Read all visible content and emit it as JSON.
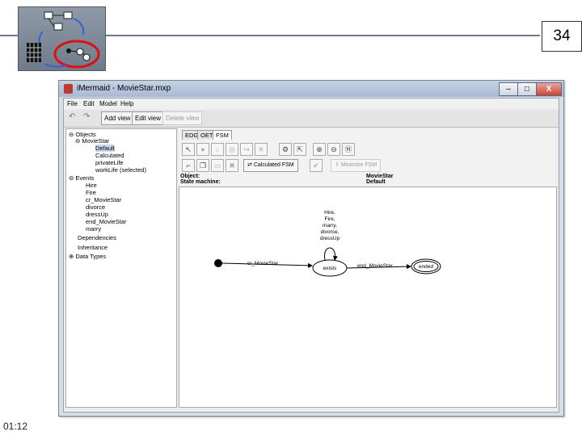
{
  "slide": {
    "page_number": "34",
    "clock": "01:12"
  },
  "window": {
    "title": "iMermaid - MovieStar.mxp",
    "controls": {
      "minimize": "–",
      "maximize": "□",
      "close": "X"
    }
  },
  "menu": [
    "File",
    "Edit",
    "Model",
    "Help"
  ],
  "toolbar": {
    "undo": "↶",
    "redo": "↷",
    "add_view": "Add view",
    "edit_view": "Edit view",
    "delete_view": "Delete view"
  },
  "tree": {
    "items": [
      {
        "label": "Objects",
        "prefix": "⊖ "
      },
      {
        "label": "MovieStar",
        "prefix": "⊖ "
      },
      {
        "label": "Default",
        "prefix": ""
      },
      {
        "label": "Calculated",
        "prefix": ""
      },
      {
        "label": "privateLife",
        "prefix": ""
      },
      {
        "label": "workLife (selected)",
        "prefix": ""
      },
      {
        "label": "Events",
        "prefix": "⊖ "
      },
      {
        "label": "Hire",
        "prefix": ""
      },
      {
        "label": "Fire",
        "prefix": ""
      },
      {
        "label": "cr_MovieStar",
        "prefix": ""
      },
      {
        "label": "divorce",
        "prefix": ""
      },
      {
        "label": "dressUp",
        "prefix": ""
      },
      {
        "label": "end_MovieStar",
        "prefix": ""
      },
      {
        "label": "marry",
        "prefix": ""
      },
      {
        "label": "Dependencies",
        "prefix": ""
      },
      {
        "label": "Inheritance",
        "prefix": ""
      },
      {
        "label": "Data Types",
        "prefix": "⊕ "
      }
    ]
  },
  "tabs": [
    "EDG",
    "OET",
    "FSM"
  ],
  "fsm_toolbar": {
    "calculated_fsm": "Calculated FSM",
    "minimize_fsm": "Minimize FSM"
  },
  "view_labels": {
    "object_label": "Object:",
    "state_machine_label": "State machine:",
    "object_value": "MovieStar",
    "state_machine_value": "Default"
  },
  "diagram": {
    "self_loop_events": [
      "Hire,",
      "Fire,",
      "marry,",
      "divorce,",
      "dressUp"
    ],
    "create_event": "cr_MovieStar",
    "end_event": "end_MovieStar",
    "state_exists": "exists",
    "state_ended": "ended"
  }
}
